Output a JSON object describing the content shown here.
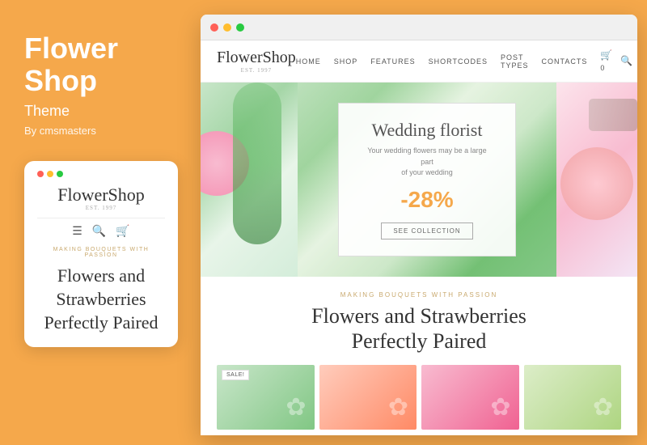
{
  "page": {
    "title": "Flower Shop Theme"
  },
  "left": {
    "title_line1": "Flower",
    "title_line2": "Shop",
    "subtitle": "Theme",
    "by": "By cmsmasters"
  },
  "mobile_card": {
    "logo": "FlowerShop",
    "est": "EST. 1997",
    "tagline": "Making Bouquets with Passion",
    "heading": "Flowers and Strawberries Perfectly Paired"
  },
  "browser": {
    "dots": [
      "red",
      "yellow",
      "green"
    ]
  },
  "navbar": {
    "logo": "FlowerShop",
    "est": "EST. 1997",
    "links": [
      "Home",
      "Shop",
      "Features",
      "Shortcodes",
      "Post Types",
      "Contacts"
    ],
    "cart_count": "0"
  },
  "hero": {
    "promo_title": "Wedding florist",
    "promo_sub": "Your wedding flowers may be a large part\nof your wedding",
    "discount": "-28%",
    "btn_label": "See Collection"
  },
  "below": {
    "tagline": "Making Bouquets with Passion",
    "heading_line1": "Flowers and Strawberries",
    "heading_line2": "Perfectly Paired"
  },
  "products": [
    {
      "sale": "SALE!"
    },
    {},
    {},
    {}
  ]
}
